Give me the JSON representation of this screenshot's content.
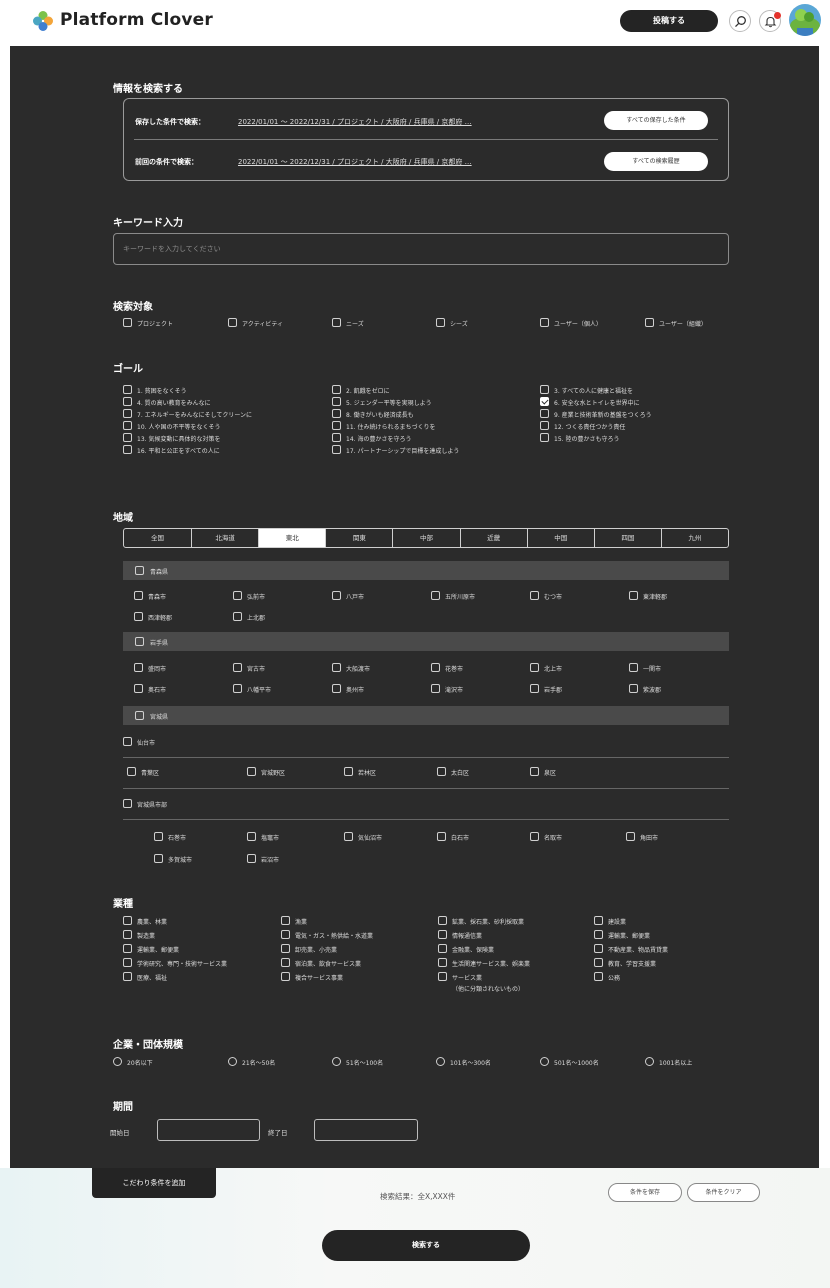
{
  "header": {
    "brand": "Platform Clover",
    "post_button": "投稿する"
  },
  "saved_search": {
    "title": "情報を検索する",
    "saved_label": "保存した条件で検索：",
    "saved_value": "2022/01/01 ～ 2022/12/31 / プロジェクト / 大阪府 / 兵庫県 / 京都府 …",
    "saved_button": "すべての保存した条件",
    "previous_label": "前回の条件で検索：",
    "previous_value": "2022/01/01 ～ 2022/12/31 / プロジェクト / 大阪府 / 兵庫県 / 京都府 …",
    "previous_button": "すべての検索履歴"
  },
  "keyword": {
    "title": "キーワード入力",
    "placeholder": "キーワードを入力してください"
  },
  "target": {
    "title": "検索対象",
    "items": [
      "プロジェクト",
      "アクティビティ",
      "ニーズ",
      "シーズ",
      "ユーザー（個人）",
      "ユーザー（組織）"
    ]
  },
  "goals": {
    "title": "ゴール",
    "col1": [
      "1. 貧困をなくそう",
      "4. 質の高い教育をみんなに",
      "7. エネルギーをみんなにそしてクリーンに",
      "10. 人や国の不平等をなくそう",
      "13. 気候変動に具体的な対策を",
      "16. 平和と公正をすべての人に"
    ],
    "col2": [
      "2. 飢餓をゼロに",
      "5. ジェンダー平等を実現しよう",
      "8. 働きがいも経済成長も",
      "11. 住み続けられるまちづくりを",
      "14. 海の豊かさを守ろう",
      "17. パートナーシップで目標を達成しよう"
    ],
    "col3": [
      "3. すべての人に健康と福祉を",
      "6. 安全な水とトイレを世界中に",
      "9. 産業と技術革新の基盤をつくろう",
      "12. つくる責任つかう責任",
      "15. 陸の豊かさも守ろう"
    ],
    "checked": "6. 安全な水とトイレを世界中に"
  },
  "region": {
    "title": "地域",
    "tabs": [
      "全国",
      "北海道",
      "東北",
      "関東",
      "中部",
      "近畿",
      "中国",
      "四国",
      "九州"
    ],
    "active_tab": "東北",
    "aomori": {
      "name": "青森県",
      "cities_row1": [
        "青森市",
        "弘前市",
        "八戸市",
        "五所川原市",
        "むつ市",
        "東津軽郡"
      ],
      "cities_row2": [
        "西津軽郡",
        "上北郡"
      ]
    },
    "iwate": {
      "name": "岩手県",
      "cities_row1": [
        "盛岡市",
        "宮古市",
        "大船渡市",
        "花巻市",
        "北上市",
        "一関市"
      ],
      "cities_row2": [
        "奥石市",
        "八幡平市",
        "奥州市",
        "滝沢市",
        "岩手郡",
        "紫波郡"
      ]
    },
    "miyagi": {
      "name": "宮城県",
      "sendai": "仙台市",
      "wards": [
        "青葉区",
        "宮城野区",
        "若林区",
        "太白区",
        "泉区"
      ],
      "county": "宮城県市部",
      "county_row1": [
        "石巻市",
        "塩竈市",
        "気仙沼市",
        "白石市",
        "名取市",
        "角田市"
      ],
      "county_row2": [
        "多賀城市",
        "岩沼市"
      ]
    }
  },
  "industry": {
    "title": "業種",
    "col1": [
      "農業、林業",
      "製造業",
      "運輸業、郵便業",
      "学術研究、専門・技術サービス業",
      "医療、福祉"
    ],
    "col2": [
      "漁業",
      "電気・ガス・熱供給・水道業",
      "卸売業、小売業",
      "宿泊業、飲食サービス業",
      "複合サービス事業"
    ],
    "col3": [
      "鉱業、採石業、砂利採取業",
      "情報通信業",
      "金融業、保険業",
      "生活関連サービス業、娯楽業",
      "サービス業"
    ],
    "col3_note": "（他に分類されないもの）",
    "col4": [
      "建設業",
      "運輸業、郵便業",
      "不動産業、物品賃貸業",
      "教育、学習支援業",
      "公務"
    ]
  },
  "company_size": {
    "title": "企業・団体規模",
    "options": [
      "20名以下",
      "21名～50名",
      "51名～100名",
      "101名～300名",
      "501名～1000名",
      "1001名以上"
    ]
  },
  "period": {
    "title": "期間",
    "start_label": "開始日",
    "end_label": "終了日"
  },
  "footer": {
    "add_condition": "こだわり条件を追加",
    "result": "検索結果：全X,XXX件",
    "save_button": "条件を保存",
    "clear_button": "条件をクリア",
    "search_button": "検索する"
  }
}
